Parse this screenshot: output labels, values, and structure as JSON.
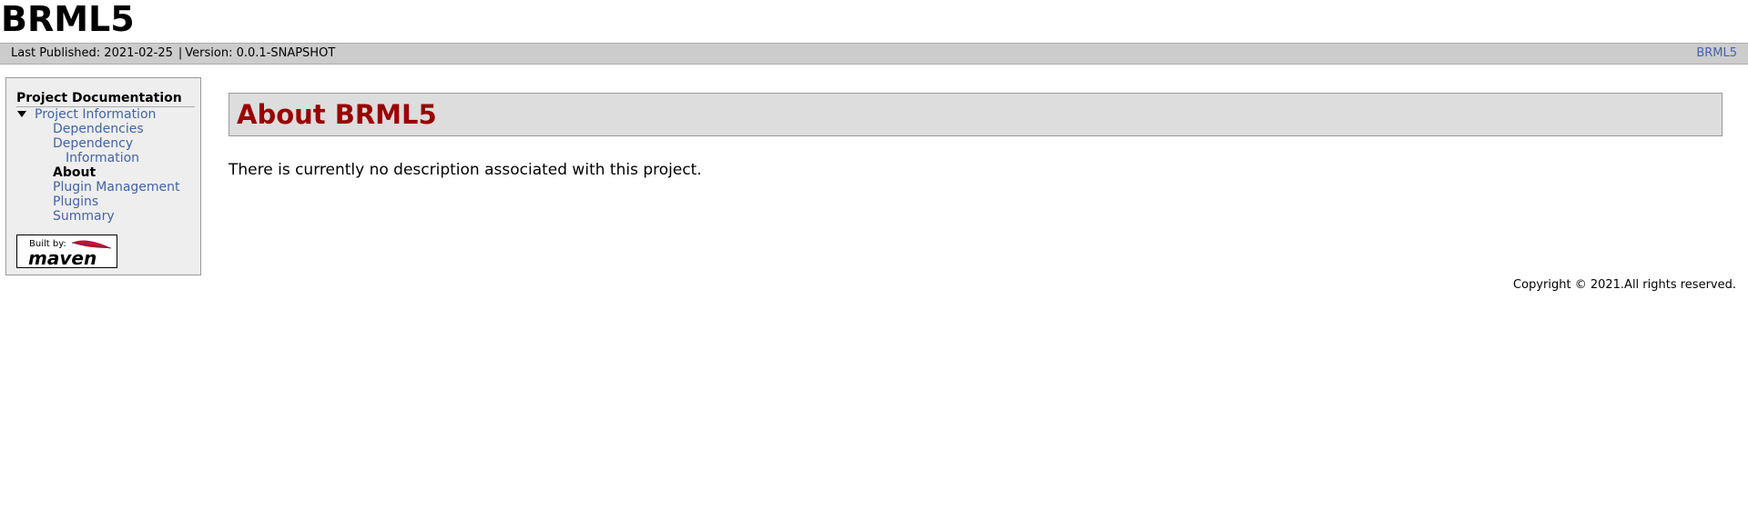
{
  "banner": {
    "site_name": "BRML5"
  },
  "breadcrumbs": {
    "published": "Last Published: 2021-02-25",
    "separator": "|",
    "version": "Version: 0.0.1-SNAPSHOT",
    "right_link": "BRML5"
  },
  "sidebar": {
    "heading": "Project Documentation",
    "group_label": "Project Information",
    "items": [
      {
        "label": "Dependencies"
      },
      {
        "label": "Dependency"
      },
      {
        "label": "Information"
      },
      {
        "label": "About"
      },
      {
        "label": "Plugin Management"
      },
      {
        "label": "Plugins"
      },
      {
        "label": "Summary"
      }
    ],
    "badge": {
      "prefix": "Built by:",
      "name": "maven",
      "accent": "#e8a33c",
      "feather": "#c8102e"
    }
  },
  "main": {
    "title": "About BRML5",
    "description": "There is currently no description associated with this project."
  },
  "footer": {
    "copyright": "Copyright © 2021.All rights reserved."
  },
  "colors": {
    "link": "#4363a6",
    "title": "#990000",
    "bar": "#cccccc",
    "panel": "#eeeeee"
  }
}
